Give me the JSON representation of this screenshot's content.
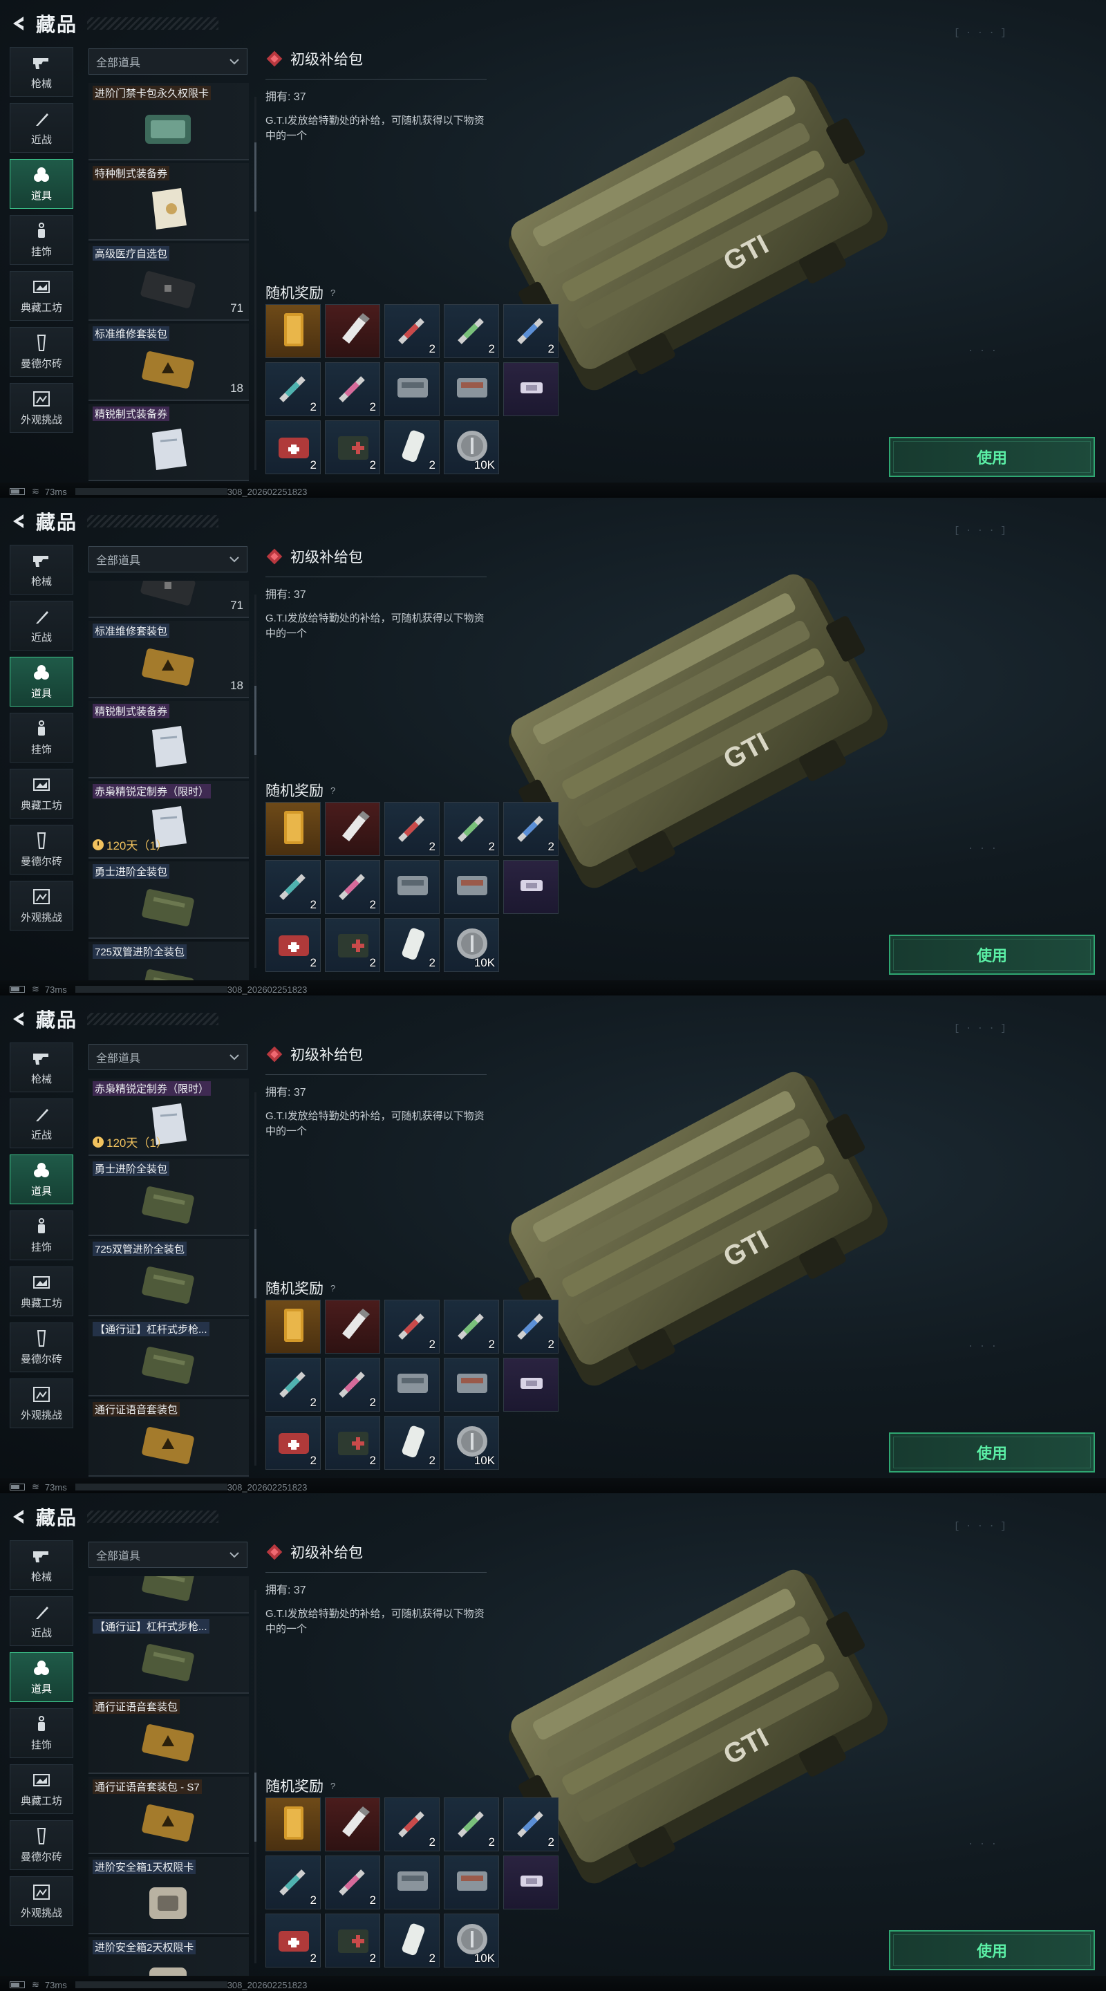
{
  "header": {
    "title": "藏品"
  },
  "nav": [
    {
      "label": "枪械",
      "icon": "gun-icon"
    },
    {
      "label": "近战",
      "icon": "knife-icon"
    },
    {
      "label": "道具",
      "icon": "items-icon",
      "active": true
    },
    {
      "label": "挂饰",
      "icon": "charm-icon"
    },
    {
      "label": "典藏工坊",
      "icon": "workshop-icon"
    },
    {
      "label": "曼德尔砖",
      "icon": "brick-icon"
    },
    {
      "label": "外观挑战",
      "icon": "challenge-icon"
    }
  ],
  "filter": {
    "label": "全部道具"
  },
  "detail": {
    "name": "初级补给包",
    "owned": "拥有: 37",
    "description": "G.T.I发放给特勤处的补给，可随机获得以下物资中的一个",
    "rewards_title": "随机奖励",
    "rewards_help": "?",
    "rewards": [
      {
        "icon": "gold-bar-icon",
        "count": "",
        "tone": "gold"
      },
      {
        "icon": "usb-drive-icon",
        "count": "",
        "tone": "red"
      },
      {
        "icon": "red-syringe-icon",
        "count": "2",
        "tone": "blue"
      },
      {
        "icon": "green-syringe-icon",
        "count": "2",
        "tone": "blue"
      },
      {
        "icon": "blue-syringe-icon",
        "count": "2",
        "tone": "blue"
      },
      {
        "icon": "teal-syringe-icon",
        "count": "2",
        "tone": "blue"
      },
      {
        "icon": "pink-syringe-icon",
        "count": "2",
        "tone": "blue"
      },
      {
        "icon": "ammo-box-icon",
        "count": "",
        "tone": "blue"
      },
      {
        "icon": "ammo-box-red-icon",
        "count": "",
        "tone": "blue"
      },
      {
        "icon": "tape-icon",
        "count": "",
        "tone": "purple"
      },
      {
        "icon": "medkit-icon",
        "count": "2",
        "tone": "blue"
      },
      {
        "icon": "first-aid-kit-icon",
        "count": "2",
        "tone": "blue"
      },
      {
        "icon": "bandage-icon",
        "count": "2",
        "tone": "blue"
      },
      {
        "icon": "coin-icon",
        "count": "10K",
        "tone": "blue"
      }
    ],
    "use_label": "使用",
    "case_text": "GTI"
  },
  "status": {
    "ping": "73ms",
    "build": "308_202602251823"
  },
  "panels": [
    {
      "scroll_thumb": 0.15,
      "items": [
        {
          "name": "进阶门禁卡包永久权限卡",
          "qty": "",
          "timer": "",
          "tag": "brown",
          "thumb": "keycard"
        },
        {
          "name": "特种制式装备券",
          "qty": "",
          "timer": "",
          "tag": "brown",
          "thumb": "paper"
        },
        {
          "name": "高级医疗自选包",
          "qty": "71",
          "timer": "",
          "tag": "blue",
          "thumb": "darkcase"
        },
        {
          "name": "标准维修套装包",
          "qty": "18",
          "timer": "",
          "tag": "blue",
          "thumb": "goldcase"
        },
        {
          "name": "精锐制式装备券",
          "qty": "",
          "timer": "",
          "tag": "purple",
          "thumb": "paper2"
        }
      ]
    },
    {
      "scroll_thumb": 0.3,
      "items": [
        {
          "name": "",
          "qty": "71",
          "timer": "",
          "tag": "blue",
          "thumb": "darkcase"
        },
        {
          "name": "标准维修套装包",
          "qty": "18",
          "timer": "",
          "tag": "blue",
          "thumb": "goldcase"
        },
        {
          "name": "精锐制式装备券",
          "qty": "",
          "timer": "",
          "tag": "purple",
          "thumb": "paper2"
        },
        {
          "name": "赤枭精锐定制券（限时）",
          "qty": "",
          "timer": "120天（1）",
          "tag": "purple",
          "thumb": "paper2"
        },
        {
          "name": "勇士进阶全装包",
          "qty": "",
          "timer": "",
          "tag": "blue",
          "thumb": "greencase"
        },
        {
          "name": "725双管进阶全装包",
          "qty": "",
          "timer": "",
          "tag": "blue",
          "thumb": "greencase"
        }
      ]
    },
    {
      "scroll_thumb": 0.45,
      "items": [
        {
          "name": "赤枭精锐定制券（限时）",
          "qty": "",
          "timer": "120天（1）",
          "tag": "purple",
          "thumb": "paper2"
        },
        {
          "name": "勇士进阶全装包",
          "qty": "",
          "timer": "",
          "tag": "blue",
          "thumb": "greencase"
        },
        {
          "name": "725双管进阶全装包",
          "qty": "",
          "timer": "",
          "tag": "blue",
          "thumb": "greencase"
        },
        {
          "name": "【通行证】杠杆式步枪...",
          "qty": "",
          "timer": "",
          "tag": "blue",
          "thumb": "greencase"
        },
        {
          "name": "通行证语音套装包",
          "qty": "",
          "timer": "",
          "tag": "brown",
          "thumb": "goldcase"
        }
      ]
    },
    {
      "scroll_thumb": 0.6,
      "items": [
        {
          "name": "",
          "qty": "",
          "timer": "",
          "tag": "blue",
          "thumb": "greencase"
        },
        {
          "name": "【通行证】杠杆式步枪...",
          "qty": "",
          "timer": "",
          "tag": "blue",
          "thumb": "greencase"
        },
        {
          "name": "通行证语音套装包",
          "qty": "",
          "timer": "",
          "tag": "brown",
          "thumb": "goldcase"
        },
        {
          "name": "通行证语音套装包 - S7",
          "qty": "",
          "timer": "",
          "tag": "brown",
          "thumb": "goldcase"
        },
        {
          "name": "进阶安全箱1天权限卡",
          "qty": "",
          "timer": "",
          "tag": "blue",
          "thumb": "safebox"
        },
        {
          "name": "进阶安全箱2天权限卡",
          "qty": "",
          "timer": "",
          "tag": "blue",
          "thumb": "safebox"
        }
      ]
    }
  ]
}
